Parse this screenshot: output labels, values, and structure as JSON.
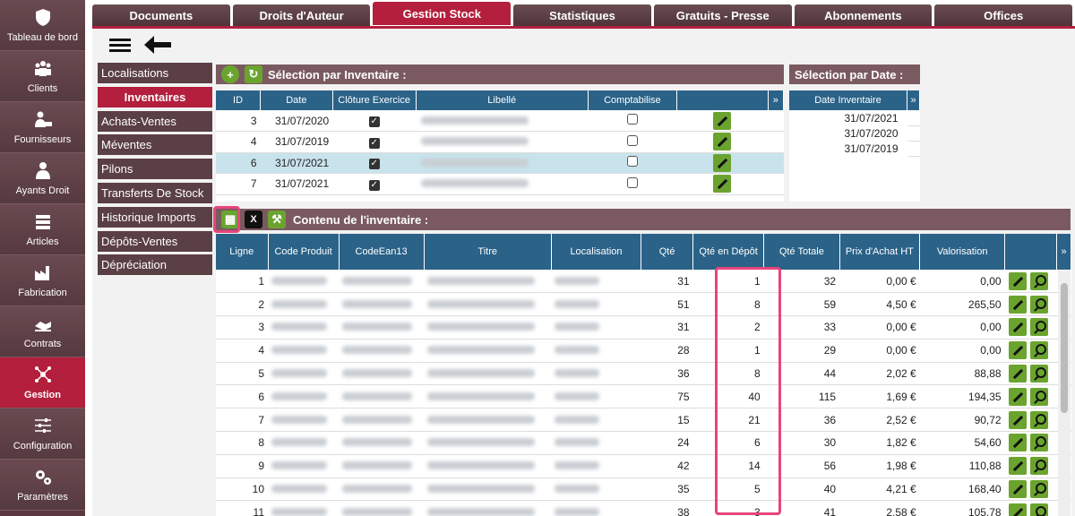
{
  "sidebar": [
    {
      "label": "Tableau de bord",
      "icon": "shield-icon"
    },
    {
      "label": "Clients",
      "icon": "users-icon"
    },
    {
      "label": "Fournisseurs",
      "icon": "supplier-icon"
    },
    {
      "label": "Ayants Droit",
      "icon": "person-icon"
    },
    {
      "label": "Articles",
      "icon": "books-icon"
    },
    {
      "label": "Fabrication",
      "icon": "factory-icon"
    },
    {
      "label": "Contrats",
      "icon": "handshake-icon"
    },
    {
      "label": "Gestion",
      "icon": "network-icon",
      "active": true
    },
    {
      "label": "Configuration",
      "icon": "sliders-icon"
    },
    {
      "label": "Paramètres",
      "icon": "gears-icon"
    }
  ],
  "tabs": [
    {
      "label": "Documents"
    },
    {
      "label": "Droits d'Auteur"
    },
    {
      "label": "Gestion Stock",
      "active": true
    },
    {
      "label": "Statistiques"
    },
    {
      "label": "Gratuits - Presse"
    },
    {
      "label": "Abonnements"
    },
    {
      "label": "Offices"
    }
  ],
  "menu": [
    {
      "label": "Localisations"
    },
    {
      "label": "Inventaires",
      "active": true
    },
    {
      "label": "Achats-Ventes"
    },
    {
      "label": "Méventes"
    },
    {
      "label": "Pilons"
    },
    {
      "label": "Transferts De Stock"
    },
    {
      "label": "Historique Imports"
    },
    {
      "label": "Dépôts-Ventes"
    },
    {
      "label": "Dépréciation"
    }
  ],
  "inventory": {
    "title": "Sélection par Inventaire :",
    "columns": [
      "ID",
      "Date",
      "Clôture Exercice",
      "Libellé",
      "Comptabilise"
    ],
    "rows": [
      {
        "id": "3",
        "date": "31/07/2020",
        "cloture": true,
        "compta": false
      },
      {
        "id": "4",
        "date": "31/07/2019",
        "cloture": true,
        "compta": false
      },
      {
        "id": "6",
        "date": "31/07/2021",
        "cloture": true,
        "compta": false,
        "selected": true
      },
      {
        "id": "7",
        "date": "31/07/2021",
        "cloture": true,
        "compta": false
      }
    ]
  },
  "dates": {
    "title": "Sélection par Date :",
    "column": "Date Inventaire",
    "values": [
      "31/07/2021",
      "31/07/2020",
      "31/07/2019"
    ]
  },
  "content": {
    "title": "Contenu de l'inventaire :",
    "columns": [
      "Ligne",
      "Code Produit",
      "CodeEan13",
      "Titre",
      "Localisation",
      "Qté",
      "Qté en Dépôt",
      "Qté Totale",
      "Prix d'Achat HT",
      "Valorisation"
    ],
    "rows": [
      {
        "ligne": "1",
        "qte": "31",
        "depot": "1",
        "total": "32",
        "prix": "0,00 €",
        "valo": "0,00"
      },
      {
        "ligne": "2",
        "qte": "51",
        "depot": "8",
        "total": "59",
        "prix": "4,50 €",
        "valo": "265,50"
      },
      {
        "ligne": "3",
        "qte": "31",
        "depot": "2",
        "total": "33",
        "prix": "0,00 €",
        "valo": "0,00"
      },
      {
        "ligne": "4",
        "qte": "28",
        "depot": "1",
        "total": "29",
        "prix": "0,00 €",
        "valo": "0,00"
      },
      {
        "ligne": "5",
        "qte": "36",
        "depot": "8",
        "total": "44",
        "prix": "2,02 €",
        "valo": "88,88"
      },
      {
        "ligne": "6",
        "qte": "75",
        "depot": "40",
        "total": "115",
        "prix": "1,69 €",
        "valo": "194,35"
      },
      {
        "ligne": "7",
        "qte": "15",
        "depot": "21",
        "total": "36",
        "prix": "2,52 €",
        "valo": "90,72"
      },
      {
        "ligne": "8",
        "qte": "24",
        "depot": "6",
        "total": "30",
        "prix": "1,82 €",
        "valo": "54,60"
      },
      {
        "ligne": "9",
        "qte": "42",
        "depot": "14",
        "total": "56",
        "prix": "1,98 €",
        "valo": "110,88"
      },
      {
        "ligne": "10",
        "qte": "35",
        "depot": "5",
        "total": "40",
        "prix": "4,21 €",
        "valo": "168,40"
      },
      {
        "ligne": "11",
        "qte": "38",
        "depot": "3",
        "total": "41",
        "prix": "2,58 €",
        "valo": "105,78"
      }
    ]
  },
  "colors": {
    "accent": "#b31f3c",
    "header": "#2a6288",
    "green": "#6aa42f",
    "highlight": "#e8457a"
  }
}
